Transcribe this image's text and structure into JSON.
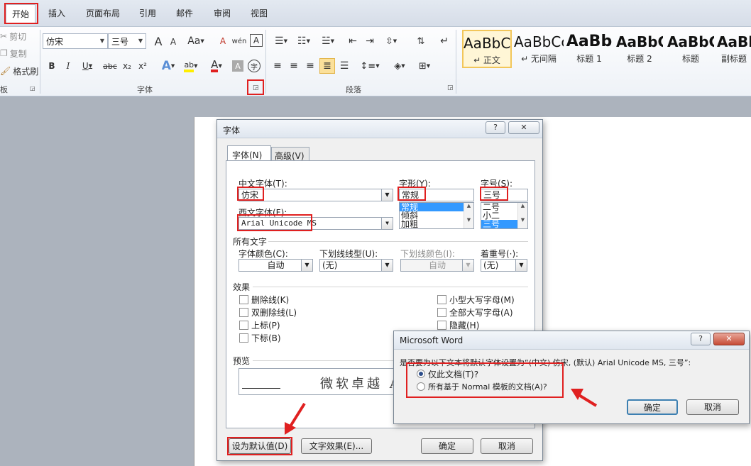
{
  "ribbon": {
    "tabs": [
      "开始",
      "插入",
      "页面布局",
      "引用",
      "邮件",
      "审阅",
      "视图"
    ],
    "clipboard": {
      "cut": "剪切",
      "copy": "复制",
      "format_painter": "格式刷",
      "group": "板"
    },
    "font_group": {
      "font_name": "仿宋",
      "font_size": "三号",
      "label": "字体",
      "bold": "B",
      "italic": "I",
      "underline": "U",
      "strike": "abc",
      "sub": "x₂",
      "sup": "x²",
      "change_case": "Aa",
      "clear": "A",
      "font_color": "A",
      "highlight": "ab",
      "phonetic": "wén",
      "char_border": "A",
      "grow": "A",
      "shrink": "A"
    },
    "paragraph_group": {
      "label": "段落"
    },
    "styles": [
      {
        "sample": "AaBbCc",
        "name": "↵ 正文"
      },
      {
        "sample": "AaBbCc",
        "name": "↵ 无间隔"
      },
      {
        "sample": "AaBb",
        "name": "标题 1"
      },
      {
        "sample": "AaBbC",
        "name": "标题 2"
      },
      {
        "sample": "AaBbC",
        "name": "标题"
      },
      {
        "sample": "AaBl",
        "name": "副标题"
      }
    ]
  },
  "font_dialog": {
    "title": "字体",
    "help": "?",
    "close": "✕",
    "tabs": [
      "字体(N)",
      "高级(V)"
    ],
    "cn_font_label": "中文字体(T):",
    "cn_font_value": "仿宋",
    "west_font_label": "西文字体(F):",
    "west_font_value": "Arial Unicode MS",
    "style_label": "字形(Y):",
    "style_value": "常规",
    "style_list": [
      "常规",
      "倾斜",
      "加粗"
    ],
    "size_label": "字号(S):",
    "size_value": "三号",
    "size_list": [
      "二号",
      "小二",
      "三号"
    ],
    "all_text_label": "所有文字",
    "color_label": "字体颜色(C):",
    "color_value": "自动",
    "underline_type_label": "下划线线型(U):",
    "underline_type_value": "(无)",
    "underline_color_label": "下划线颜色(I):",
    "underline_color_value": "自动",
    "emphasis_label": "着重号(·):",
    "emphasis_value": "(无)",
    "effects_label": "效果",
    "effects_left": [
      "删除线(K)",
      "双删除线(L)",
      "上标(P)",
      "下标(B)"
    ],
    "effects_right": [
      "小型大写字母(M)",
      "全部大写字母(A)",
      "隐藏(H)"
    ],
    "preview_label": "预览",
    "preview_text": "微软卓越 A",
    "buttons": {
      "set_default": "设为默认值(D)",
      "text_effects": "文字效果(E)...",
      "ok": "确定",
      "cancel": "取消"
    }
  },
  "confirm_dialog": {
    "title": "Microsoft Word",
    "help": "?",
    "close": "✕",
    "question": "是否要为以下文本将默认字体设置为“(中文) 仿宋, (默认) Arial Unicode MS, 三号”:",
    "option1": "仅此文档(T)?",
    "option2": "所有基于 Normal 模板的文档(A)?",
    "ok": "确定",
    "cancel": "取消"
  },
  "colors": {
    "highlight_red": "#e02020",
    "selection_blue": "#3399ff"
  }
}
